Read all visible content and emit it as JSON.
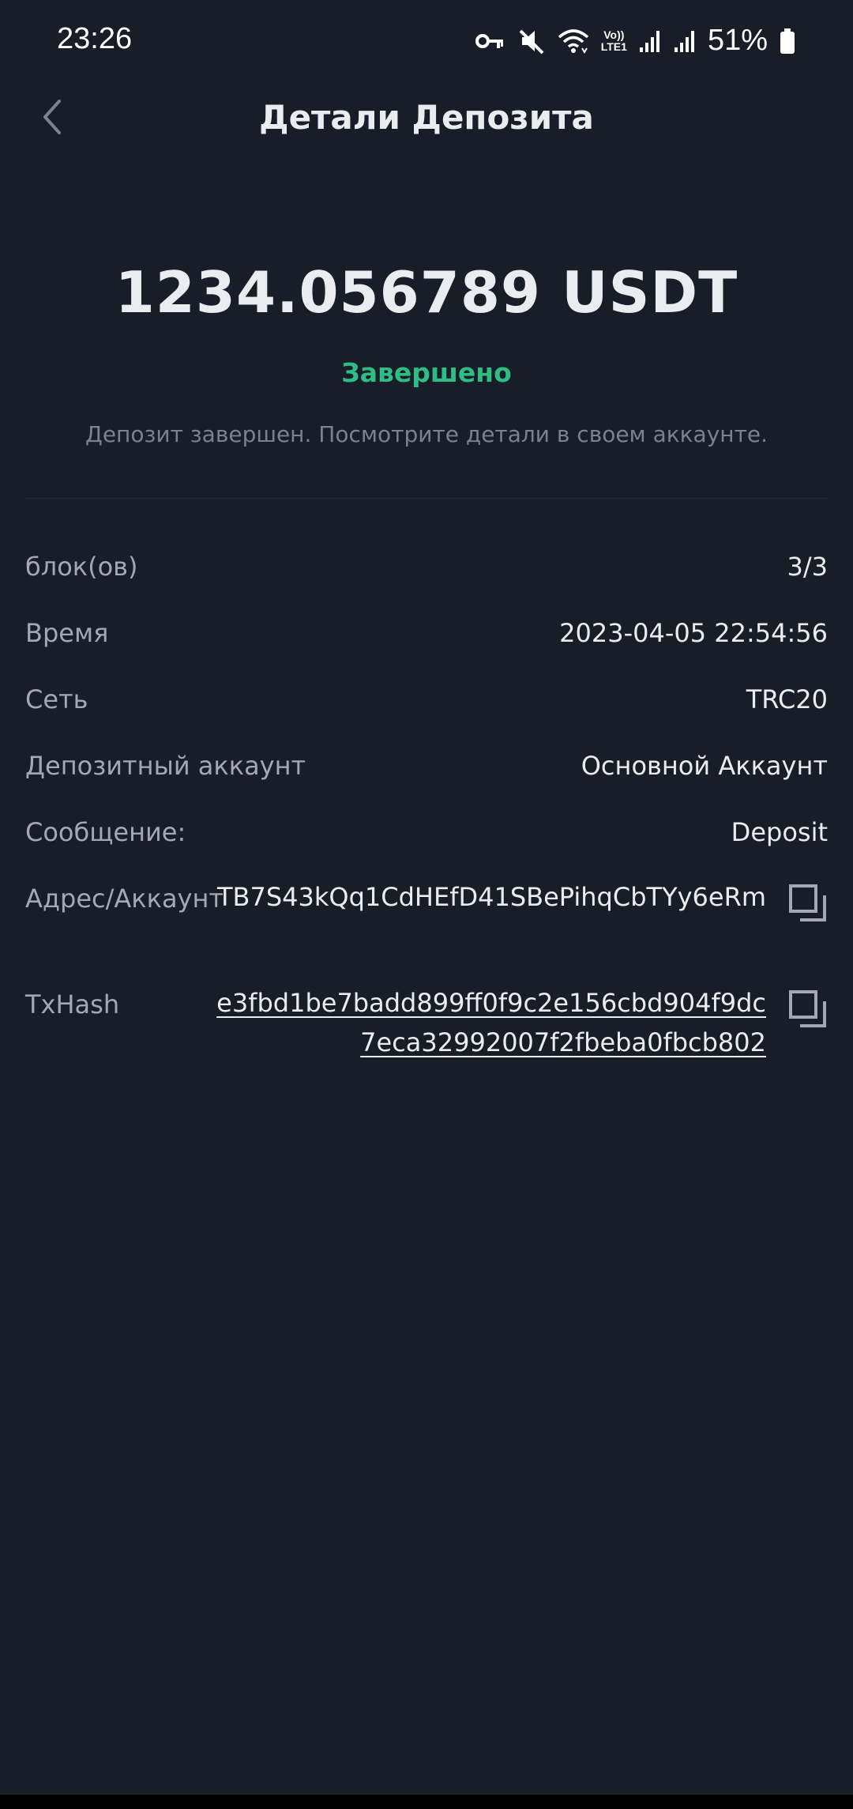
{
  "status_bar": {
    "time": "23:26",
    "battery_percent": "51%",
    "lte_top": "Vo))",
    "lte_bottom": "LTE1",
    "icons": [
      "key-icon",
      "mute-icon",
      "wifi-icon",
      "lte-icon",
      "signal-icon",
      "signal-icon",
      "battery-icon"
    ]
  },
  "header": {
    "title": "Детали Депозита",
    "back_icon": "chevron-left-icon"
  },
  "summary": {
    "amount": "1234.056789 USDT",
    "status": "Завершено",
    "description": "Депозит завершен. Посмотрите детали в своем аккаунте."
  },
  "details": {
    "blocks_label": "блок(ов)",
    "blocks_value": "3/3",
    "time_label": "Время",
    "time_value": "2023-04-05 22:54:56",
    "network_label": "Сеть",
    "network_value": "TRC20",
    "account_label": "Депозитный аккаунт",
    "account_value": "Основной Аккаунт",
    "message_label": "Сообщение:",
    "message_value": "Deposit",
    "address_label": "Адрес/Аккаунт",
    "address_value": "TB7S43kQq1CdHEfD41SBePihqCbTYy6eRm",
    "txhash_label": "TxHash",
    "txhash_value": "e3fbd1be7badd899ff0f9c2e156cbd904f9dc7eca32992007f2fbeba0fbcb802"
  },
  "colors": {
    "background": "#181d28",
    "success": "#2ebd85",
    "muted": "#7a818f",
    "label": "#a3a9b4",
    "text": "#eaecef"
  }
}
